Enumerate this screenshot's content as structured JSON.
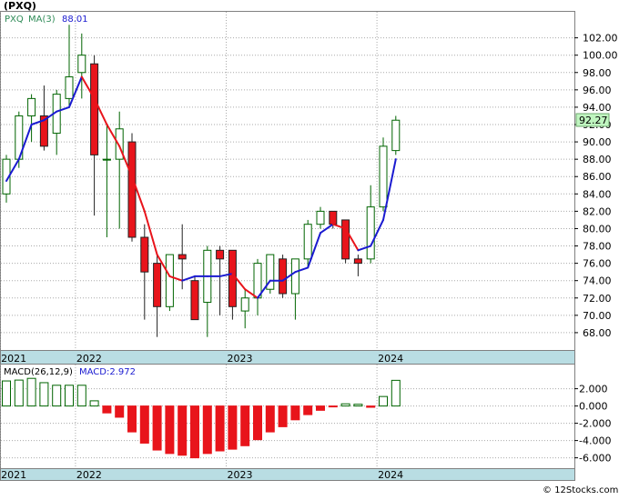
{
  "title": "(PXQ)",
  "copyright": "© 12Stocks.com",
  "colors": {
    "up_fill": "#ffffff",
    "up_stroke": "#006400",
    "down_fill": "#e8141b",
    "down_stroke": "#222222",
    "ma_up": "#1a1ad0",
    "ma_down": "#e8141b",
    "last_price_box": "#bff5bf",
    "axis_band": "#b9dde3",
    "grid": "#aaaaaa"
  },
  "chart_data": [
    {
      "type": "candlestick",
      "name": "price",
      "legend": {
        "symbol": "PXQ",
        "ma_label": "MA(3)",
        "ma_value": "88.01"
      },
      "last_price_label": "92.27",
      "ylim": [
        66.0,
        105.0
      ],
      "y_ticks": [
        "68.00",
        "70.00",
        "72.00",
        "74.00",
        "76.00",
        "78.00",
        "80.00",
        "82.00",
        "84.00",
        "86.00",
        "88.00",
        "90.00",
        "92.00",
        "94.00",
        "96.00",
        "98.00",
        "100.00",
        "102.00"
      ],
      "x_labels": [
        {
          "label": "2021",
          "index": -0.5
        },
        {
          "label": "2022",
          "index": 5.5
        },
        {
          "label": "2023",
          "index": 17.5
        },
        {
          "label": "2024",
          "index": 29.5
        }
      ],
      "candles": [
        {
          "o": 84.0,
          "h": 88.5,
          "l": 83.0,
          "c": 88.0
        },
        {
          "o": 88.0,
          "h": 93.5,
          "l": 87.0,
          "c": 93.0
        },
        {
          "o": 93.0,
          "h": 95.5,
          "l": 90.0,
          "c": 95.0
        },
        {
          "o": 93.0,
          "h": 96.5,
          "l": 89.0,
          "c": 89.5
        },
        {
          "o": 91.0,
          "h": 96.0,
          "l": 88.5,
          "c": 95.5
        },
        {
          "o": 95.0,
          "h": 103.5,
          "l": 94.0,
          "c": 97.5
        },
        {
          "o": 98.0,
          "h": 102.5,
          "l": 95.0,
          "c": 100.0
        },
        {
          "o": 99.0,
          "h": 100.0,
          "l": 81.5,
          "c": 88.5
        },
        {
          "o": 88.0,
          "h": 92.0,
          "l": 79.0,
          "c": 88.0
        },
        {
          "o": 88.0,
          "h": 93.5,
          "l": 80.0,
          "c": 91.5
        },
        {
          "o": 90.0,
          "h": 91.0,
          "l": 78.5,
          "c": 79.0
        },
        {
          "o": 79.0,
          "h": 80.5,
          "l": 69.5,
          "c": 75.0
        },
        {
          "o": 76.0,
          "h": 77.0,
          "l": 67.5,
          "c": 71.0
        },
        {
          "o": 71.0,
          "h": 77.0,
          "l": 70.5,
          "c": 77.0
        },
        {
          "o": 77.0,
          "h": 80.5,
          "l": 73.0,
          "c": 76.5
        },
        {
          "o": 74.0,
          "h": 74.5,
          "l": 69.5,
          "c": 69.5
        },
        {
          "o": 71.5,
          "h": 78.0,
          "l": 67.5,
          "c": 77.5
        },
        {
          "o": 77.5,
          "h": 78.0,
          "l": 70.0,
          "c": 76.5
        },
        {
          "o": 77.5,
          "h": 77.5,
          "l": 69.5,
          "c": 71.0
        },
        {
          "o": 70.5,
          "h": 73.0,
          "l": 68.5,
          "c": 72.0
        },
        {
          "o": 72.0,
          "h": 76.5,
          "l": 70.0,
          "c": 76.0
        },
        {
          "o": 73.0,
          "h": 77.0,
          "l": 72.5,
          "c": 77.0
        },
        {
          "o": 76.5,
          "h": 77.0,
          "l": 72.0,
          "c": 72.5
        },
        {
          "o": 72.5,
          "h": 76.5,
          "l": 69.5,
          "c": 76.5
        },
        {
          "o": 76.5,
          "h": 81.0,
          "l": 75.5,
          "c": 80.5
        },
        {
          "o": 80.5,
          "h": 82.5,
          "l": 80.0,
          "c": 82.0
        },
        {
          "o": 82.0,
          "h": 82.0,
          "l": 80.0,
          "c": 80.5
        },
        {
          "o": 81.0,
          "h": 81.0,
          "l": 76.0,
          "c": 76.5
        },
        {
          "o": 76.5,
          "h": 77.0,
          "l": 74.5,
          "c": 76.0
        },
        {
          "o": 76.5,
          "h": 85.0,
          "l": 76.0,
          "c": 82.5
        },
        {
          "o": 82.5,
          "h": 90.5,
          "l": 82.0,
          "c": 89.5
        },
        {
          "o": 89.0,
          "h": 93.0,
          "l": 88.5,
          "c": 92.5
        }
      ],
      "ma3": [
        85.5,
        88.0,
        92.0,
        92.5,
        93.5,
        94.0,
        97.5,
        95.0,
        92.0,
        89.5,
        86.0,
        82.0,
        77.0,
        74.5,
        74.0,
        74.5,
        74.5,
        74.5,
        74.8,
        73.0,
        72.0,
        74.0,
        74.0,
        75.0,
        75.5,
        79.5,
        80.5,
        80.0,
        77.5,
        78.0,
        81.0,
        88.0
      ]
    },
    {
      "type": "bar",
      "name": "macd-histogram",
      "legend": {
        "label": "MACD(26,12,9)",
        "value_label": "MACD:2.972"
      },
      "ylim": [
        -7.2,
        4.8
      ],
      "y_ticks": [
        "2.000",
        "0.000",
        "-2.000",
        "-4.000",
        "-6.000"
      ],
      "x_labels": [
        {
          "label": "2021",
          "index": -0.5
        },
        {
          "label": "2022",
          "index": 5.5
        },
        {
          "label": "2023",
          "index": 17.5
        },
        {
          "label": "2024",
          "index": 29.5
        }
      ],
      "values": [
        2.9,
        3.0,
        3.2,
        2.7,
        2.4,
        2.4,
        2.4,
        0.6,
        -0.8,
        -1.3,
        -3.0,
        -4.3,
        -5.1,
        -5.5,
        -5.7,
        -6.0,
        -5.5,
        -5.2,
        -5.0,
        -4.6,
        -3.9,
        -3.0,
        -2.4,
        -1.6,
        -1.0,
        -0.5,
        -0.1,
        0.25,
        0.2,
        -0.15,
        1.1,
        2.972
      ]
    }
  ]
}
